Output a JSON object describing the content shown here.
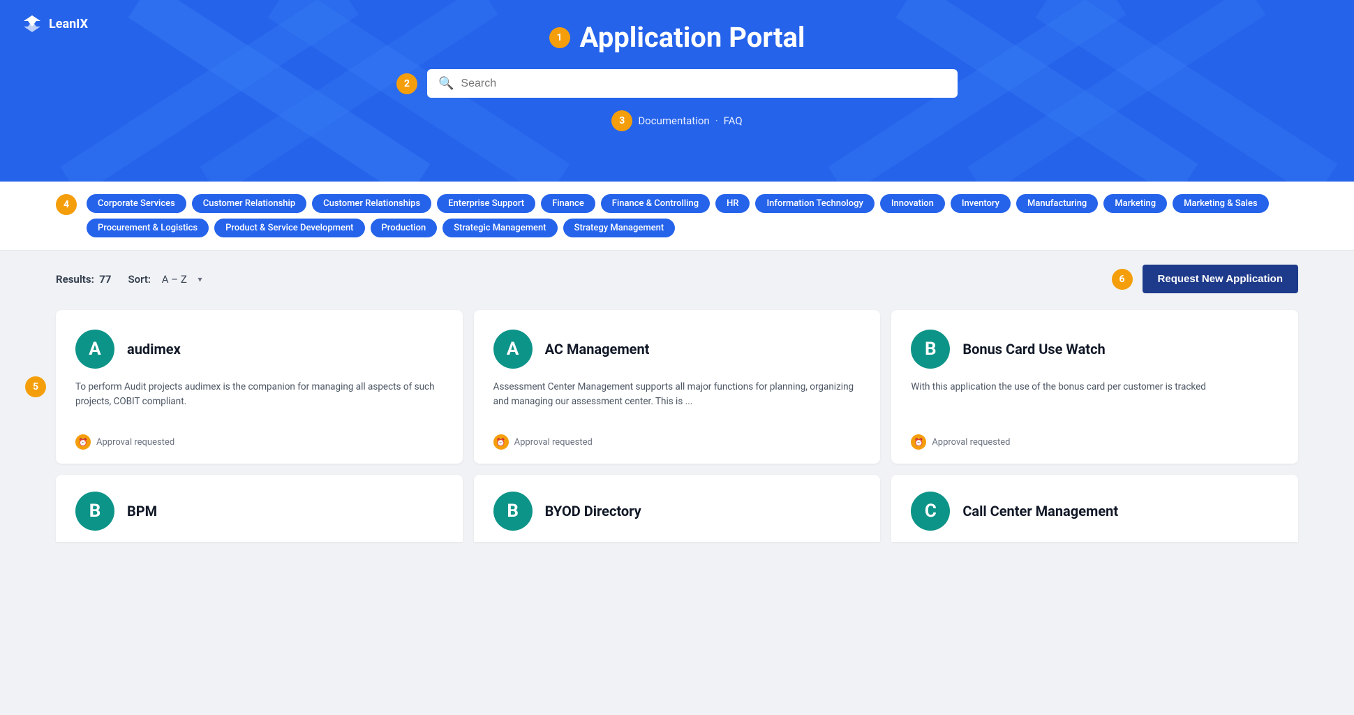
{
  "logo": {
    "text": "LeanIX"
  },
  "header": {
    "badge": "1",
    "title": "Application Portal",
    "search_placeholder": "Search",
    "links": [
      "Documentation",
      "FAQ"
    ],
    "link_separator": "·"
  },
  "tags_badge": "4",
  "tags": [
    "Corporate Services",
    "Customer Relationship",
    "Customer Relationships",
    "Enterprise Support",
    "Finance",
    "Finance & Controlling",
    "HR",
    "Information Technology",
    "Innovation",
    "Inventory",
    "Manufacturing",
    "Marketing",
    "Marketing & Sales",
    "Procurement & Logistics",
    "Product & Service Development",
    "Production",
    "Strategic Management",
    "Strategy Management"
  ],
  "results": {
    "label": "Results:",
    "count": "77",
    "sort_label": "Sort:",
    "sort_value": "A – Z"
  },
  "request_btn_badge": "6",
  "request_btn_label": "Request New Application",
  "cards_badge": "5",
  "cards": [
    {
      "initial": "A",
      "name": "audimex",
      "description": "To perform Audit projects audimex is the companion for managing all aspects of such projects, COBIT compliant.",
      "status": "Approval requested"
    },
    {
      "initial": "A",
      "name": "AC Management",
      "description": "Assessment Center Management supports all major functions for planning, organizing and managing our assessment center. This is ...",
      "status": "Approval requested"
    },
    {
      "initial": "B",
      "name": "Bonus Card Use Watch",
      "description": "With this application the use of the bonus card per customer is tracked",
      "status": "Approval requested"
    }
  ],
  "partial_cards": [
    {
      "initial": "B",
      "name": "BPM"
    },
    {
      "initial": "B",
      "name": "BYOD Directory"
    },
    {
      "initial": "C",
      "name": "Call Center Management"
    }
  ]
}
